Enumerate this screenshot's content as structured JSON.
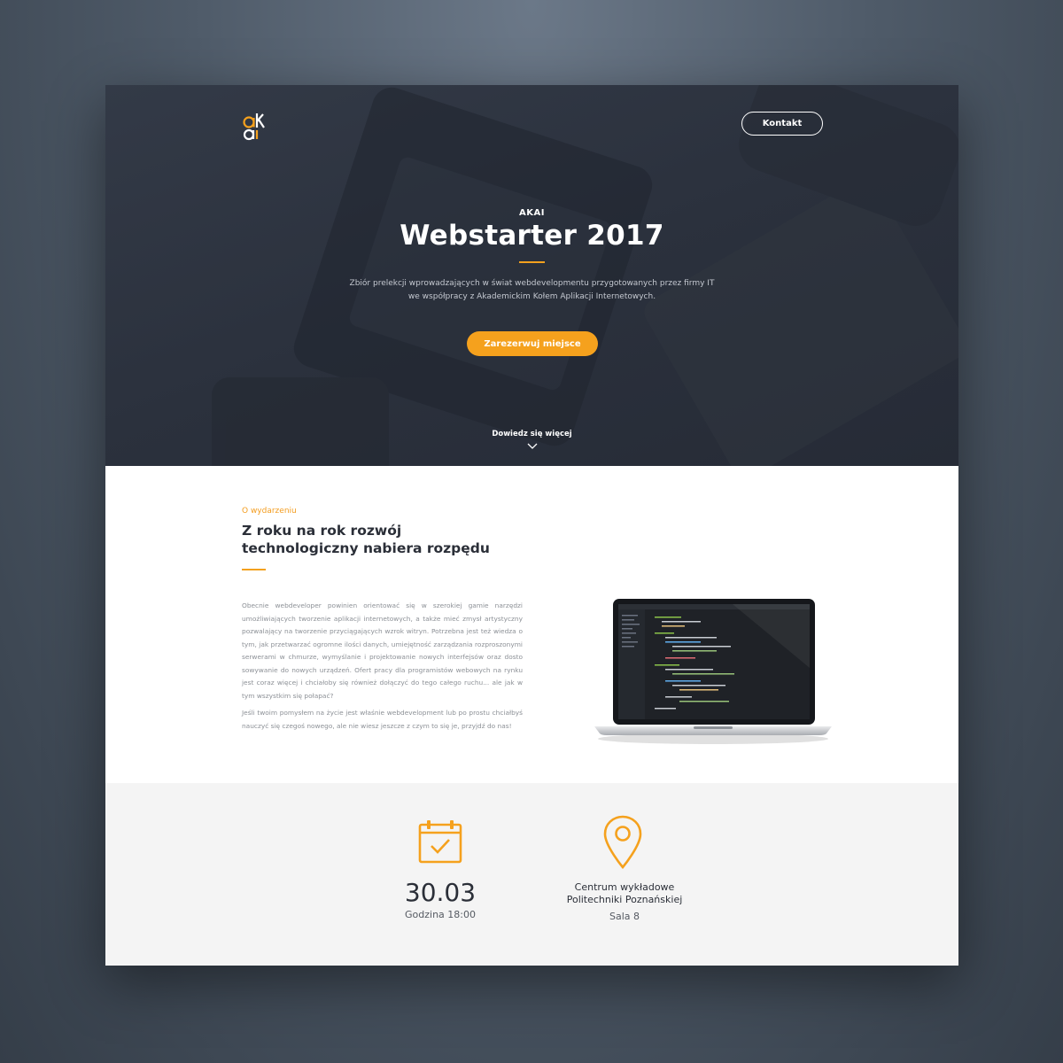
{
  "header": {
    "logo_alt": "ak",
    "contact_label": "Kontakt"
  },
  "hero": {
    "kicker": "AKAI",
    "title": "Webstarter 2017",
    "description_line1": "Zbiór prelekcji wprowadzających w świat webdevelopmentu przygotowanych przez firmy IT",
    "description_line2": "we współpracy z Akademickim Kołem Aplikacji Internetowych.",
    "cta_label": "Zarezerwuj miejsce",
    "more_label": "Dowiedz się więcej"
  },
  "about": {
    "kicker": "O wydarzeniu",
    "title_line1": "Z roku na rok rozwój",
    "title_line2": "technologiczny nabiera rozpędu",
    "paragraph1": "Obecnie webdeveloper powinien orientować się w szerokiej gamie narzędzi umożliwiających tworzenie aplikacji internetowych, a także mieć zmysł artystyczny pozwalający na tworzenie przyciągających wzrok witryn. Potrzebna jest też wiedza o tym, jak przetwarzać ogromne ilości danych, umiejętność zarządzania rozproszonymi serwerami w chmurze, wymyślanie i projektowanie nowych interfejsów oraz dosto sowywanie do nowych urządzeń. Ofert pracy dla programistów webowych na rynku jest coraz więcej i chciałoby się również dołączyć do tego całego ruchu... ale jak w tym wszystkim się połapać?",
    "paragraph2": "Jeśli twoim pomysłem na życie jest właśnie webdevelopment lub po prostu chciałbyś nauczyć się czegoś nowego, ale nie wiesz jeszcze z czym to się je, przyjdź do nas!"
  },
  "info": {
    "date": "30.03",
    "time": "Godzina 18:00",
    "place_line1": "Centrum wykładowe",
    "place_line2": "Politechniki Poznańskiej",
    "room": "Sala 8"
  },
  "colors": {
    "accent": "#f5a11d",
    "hero_bg": "#2b313d",
    "text_dark": "#2b2f38"
  },
  "icons": [
    "logo-icon",
    "chevron-down-icon",
    "calendar-check-icon",
    "map-pin-icon",
    "laptop-image"
  ]
}
